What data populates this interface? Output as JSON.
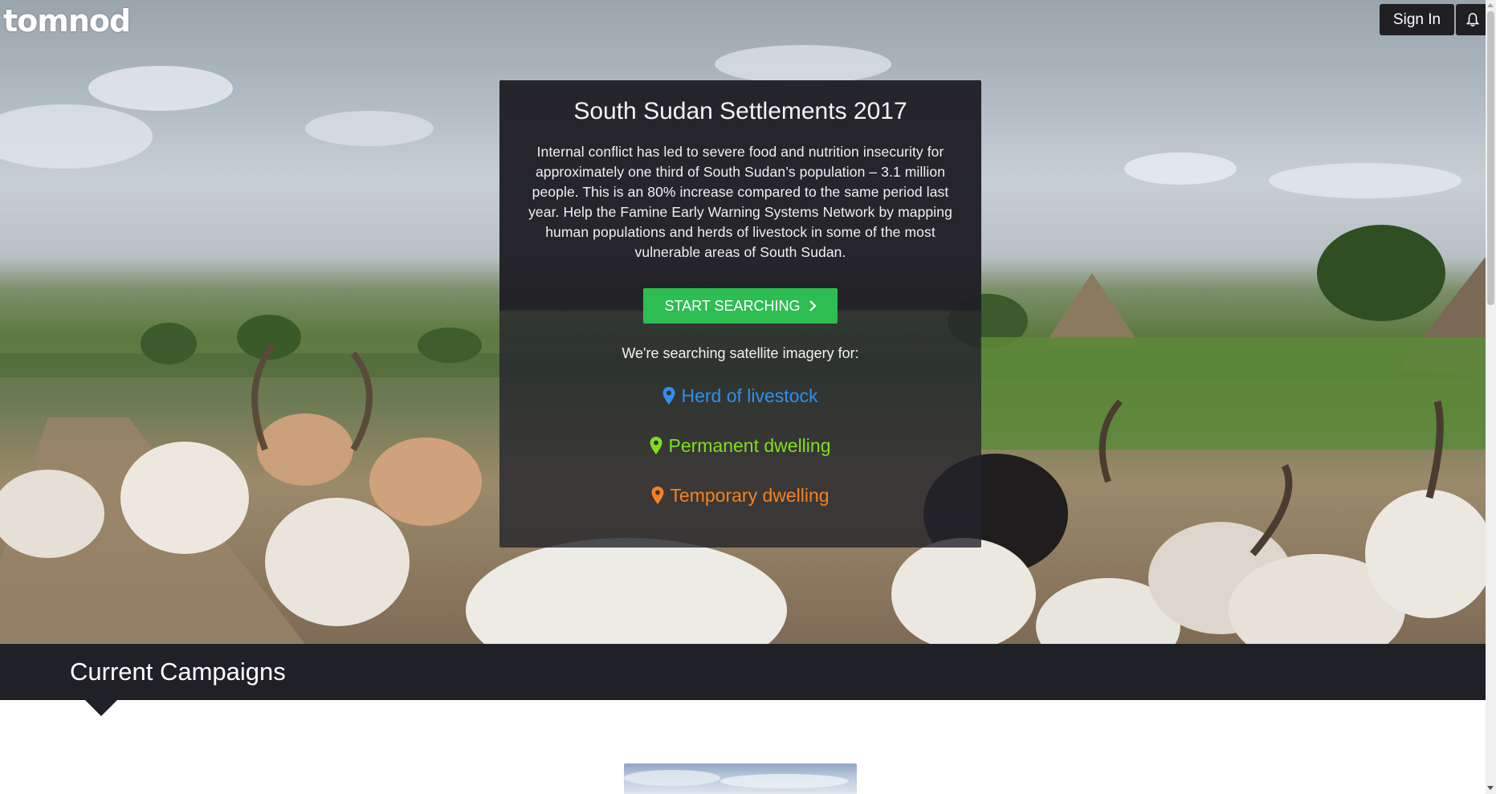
{
  "header": {
    "logo_text": "tomnod",
    "signin_label": "Sign In",
    "notification_icon": "bell-icon"
  },
  "hero": {
    "title": "South Sudan Settlements 2017",
    "description": "Internal conflict has led to severe food and nutrition insecurity for approximately one third of South Sudan’s population – 3.1 million people. This is an 80% increase compared to the same period last year. Help the Famine Early Warning Systems Network by mapping human populations and herds of livestock in some of the most vulnerable areas of South Sudan.",
    "cta_label": "START SEARCHING",
    "searching_for": "We're searching satellite imagery for:",
    "categories": [
      {
        "label": "Herd of livestock",
        "color": "#2f8ff0",
        "icon": "map-pin-icon"
      },
      {
        "label": "Permanent dwelling",
        "color": "#7de01f",
        "icon": "map-pin-icon"
      },
      {
        "label": "Temporary dwelling",
        "color": "#f5821f",
        "icon": "map-pin-icon"
      }
    ]
  },
  "campaigns": {
    "heading": "Current Campaigns"
  },
  "colors": {
    "dark_bg": "#202127",
    "cta_green": "#2ebd52"
  }
}
